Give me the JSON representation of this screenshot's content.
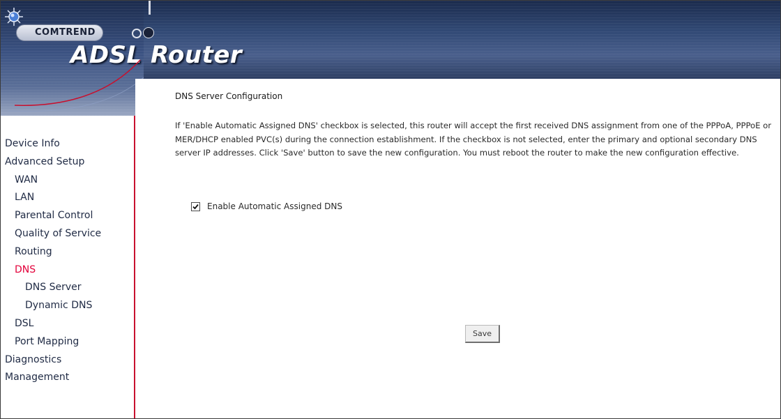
{
  "brand": {
    "company": "COMTREND",
    "product": "ADSL Router"
  },
  "sidebar": {
    "items": [
      {
        "label": "Device Info"
      },
      {
        "label": "Advanced Setup"
      },
      {
        "label": "WAN"
      },
      {
        "label": "LAN"
      },
      {
        "label": "Parental Control"
      },
      {
        "label": "Quality of Service"
      },
      {
        "label": "Routing"
      },
      {
        "label": "DNS",
        "active": true
      },
      {
        "label": "DNS Server"
      },
      {
        "label": "Dynamic DNS"
      },
      {
        "label": "DSL"
      },
      {
        "label": "Port Mapping"
      },
      {
        "label": "Diagnostics"
      },
      {
        "label": "Management"
      }
    ]
  },
  "main": {
    "heading": "DNS Server Configuration",
    "description": "If 'Enable Automatic Assigned DNS' checkbox is selected, this router will accept the first received DNS assignment from one of the PPPoA, PPPoE or MER/DHCP enabled PVC(s) during the connection establishment. If the checkbox is not selected, enter the primary and optional secondary DNS server IP addresses. Click 'Save' button to save the new configuration. You must reboot the router to make the new configuration effective.",
    "checkbox": {
      "label": "Enable Automatic Assigned DNS",
      "checked": true
    },
    "save_label": "Save"
  },
  "colors": {
    "active_nav": "#e3003a",
    "sidebar_border": "#c8102e",
    "banner": "#324a76"
  }
}
